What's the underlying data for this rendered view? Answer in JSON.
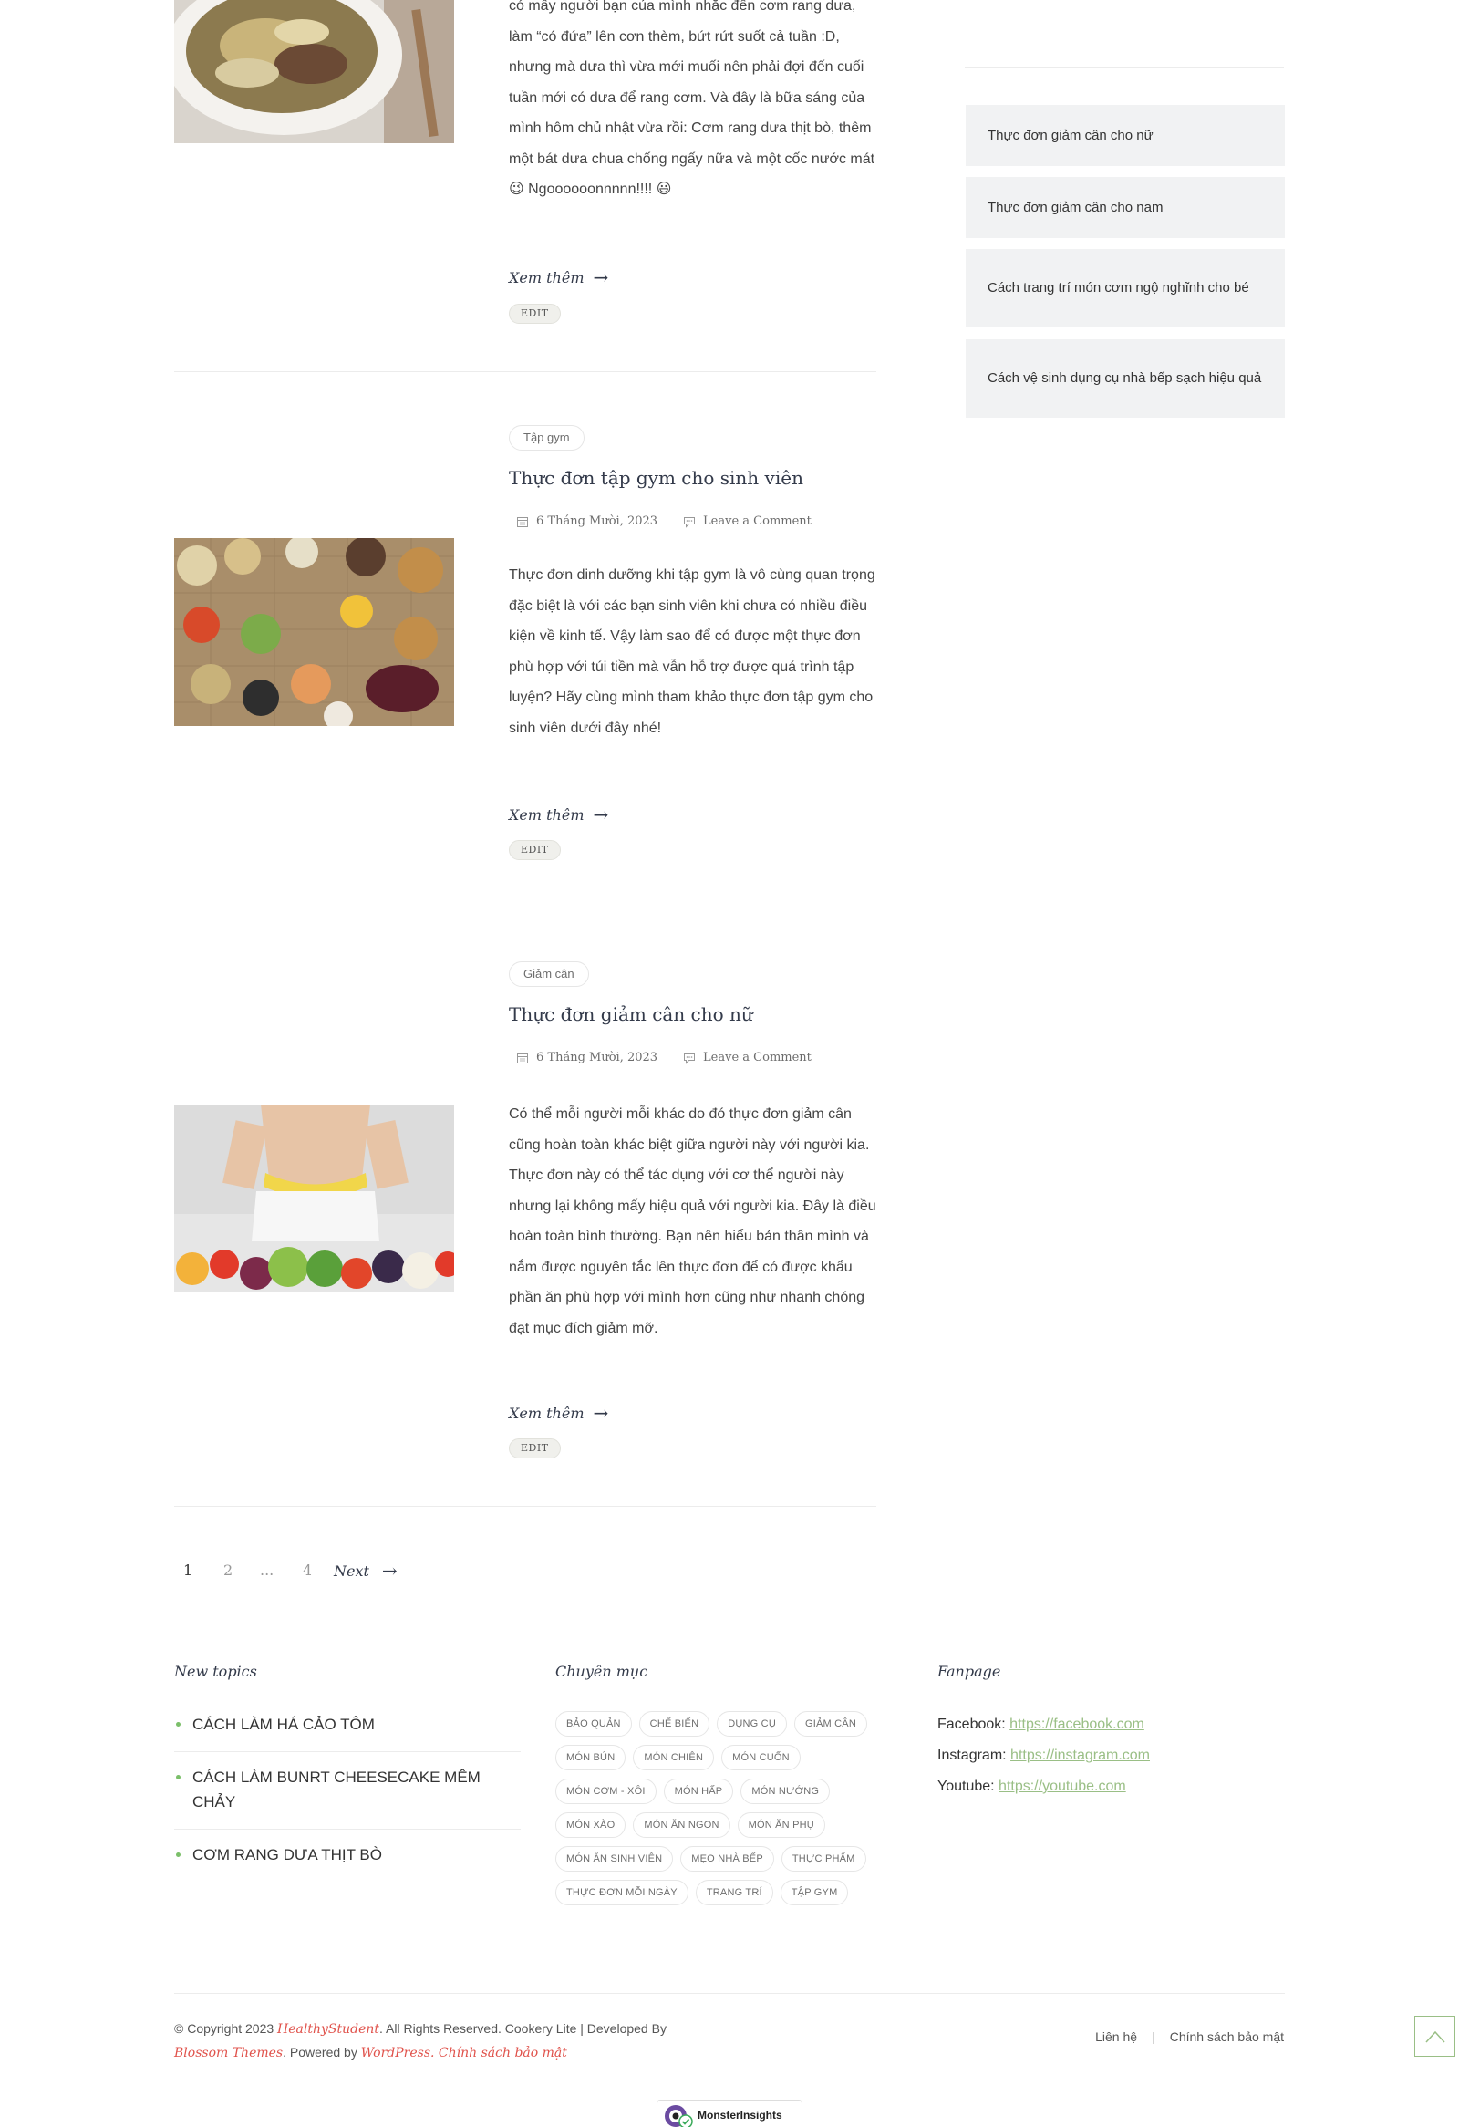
{
  "post0": {
    "excerpt": "có mấy người bạn của mình nhắc đến cơm rang dưa, làm “có đứa” lên cơn thèm, bứt rứt suốt cả tuần :D, nhưng mà dưa thì vừa mới muối nên phải đợi đến cuối tuần mới có dưa để rang cơm. Và đây là bữa sáng của mình hôm chủ nhật vừa rồi: Cơm rang dưa thịt bò, thêm một bát dưa chua chống ngấy nữa và một cốc nước mát 😉 Ngoooooonnnnn!!!! 😃",
    "readmore": "Xem thêm",
    "edit": "EDIT"
  },
  "post1": {
    "category": "Tập gym",
    "title": "Thực đơn tập gym cho sinh viên",
    "date": "6 Tháng Mười, 2023",
    "comment": "Leave a Comment",
    "excerpt": "Thực đơn dinh dưỡng khi tập gym là vô cùng quan trọng đặc biệt là với các bạn sinh viên khi chưa có nhiều điều kiện về kinh tế. Vậy làm sao để có được một thực đơn phù hợp với túi tiền mà vẫn hỗ trợ được quá trình tập luyện? Hãy cùng mình tham khảo thực đơn tập gym cho sinh viên dưới đây nhé!",
    "readmore": "Xem thêm",
    "edit": "EDIT"
  },
  "post2": {
    "category": "Giảm cân",
    "title": "Thực đơn giảm cân cho nữ",
    "date": "6 Tháng Mười, 2023",
    "comment": "Leave a Comment",
    "excerpt": "Có thể mỗi người mỗi khác do đó thực đơn giảm cân cũng hoàn toàn khác biệt giữa người này với người kia. Thực đơn này có thể tác dụng với cơ thể người này nhưng lại không mấy hiệu quả với người kia. Đây là điều hoàn toàn bình thường. Bạn nên hiểu bản thân mình và nắm được nguyên tắc lên thực đơn để có được khẩu phần ăn phù hợp với mình hơn cũng như nhanh chóng đạt mục đích giảm mỡ.",
    "readmore": "Xem thêm",
    "edit": "EDIT"
  },
  "sidebar": {
    "items": [
      "Thực đơn giảm cân cho nữ",
      "Thực đơn giảm cân cho nam",
      "Cách trang trí món cơm ngộ nghĩnh cho bé",
      "Cách vệ sinh dụng cụ nhà bếp sạch hiệu quả"
    ]
  },
  "pagination": {
    "p1": "1",
    "p2": "2",
    "dots": "...",
    "p4": "4",
    "next": "Next"
  },
  "footer": {
    "new_topics_title": "New topics",
    "topics": [
      "CÁCH LÀM HÁ CẢO TÔM",
      "CÁCH LÀM BUNRT CHEESECAKE MỀM CHẢY",
      "CƠM RANG DƯA THỊT BÒ"
    ],
    "categories_title": "Chuyên mục",
    "tags": [
      "BẢO QUẢN",
      "CHẾ BIẾN",
      "DỤNG CỤ",
      "GIẢM CÂN",
      "MÓN BÚN",
      "MÓN CHIÊN",
      "MÓN CUỐN",
      "MÓN CƠM - XÔI",
      "MÓN HẤP",
      "MÓN NƯỚNG",
      "MÓN XÀO",
      "MÓN ĂN NGON",
      "MÓN ĂN PHỤ",
      "MÓN ĂN SINH VIÊN",
      "MẸO NHÀ BẾP",
      "THỰC PHẨM",
      "THỰC ĐƠN MỖI NGÀY",
      "TRANG TRÍ",
      "TẬP GYM"
    ],
    "fanpage_title": "Fanpage",
    "facebook_label": "Facebook:",
    "facebook_url": "https://facebook.com",
    "instagram_label": "Instagram:",
    "instagram_url": "https://instagram.com",
    "youtube_label": "Youtube:",
    "youtube_url": "https://youtube.com",
    "copyright_prefix": "© Copyright 2023",
    "site_name": "HealthyStudent",
    "copyright_mid": ". All Rights Reserved. Cookery Lite | Developed By",
    "theme_name": "Blossom Themes",
    "powered_by": ". Powered by",
    "wordpress": "WordPress",
    "privacy_inline": "Chính sách bảo mật",
    "links": [
      "Liên hệ",
      "Chính sách bảo mật"
    ],
    "badge": "MonsterInsights"
  },
  "colors": {
    "accent_green": "#9abf86",
    "link_red": "#e0524b",
    "title": "#333a4a"
  }
}
